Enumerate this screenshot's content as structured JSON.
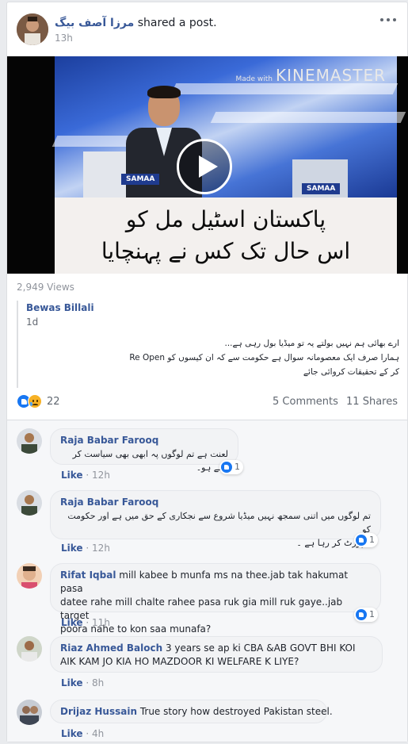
{
  "post": {
    "author": "مرزا آصف بیگ",
    "action": "shared a post.",
    "time": "13h",
    "views": "2,949 Views"
  },
  "video": {
    "watermark_prefix": "Made with",
    "watermark_brand": "KINEMASTER",
    "channel_logo": "SAMAA",
    "caption_line1": "پاکستان اسٹیل مل کو",
    "caption_line2": "اس حال تک کس نے پہنچایا"
  },
  "shared_post": {
    "author": "Bewas Billali",
    "time": "1d",
    "line1": "ارے بھائی ہم نہیں بولتے یہ تو میڈیا بول رہی ہے...",
    "line2": "ہمارا صرف ایک معصومانہ سوال ہے حکومت سے کہ ان کیسوں کو Re Open",
    "line3": "کر کے تحقیقات کروائی جائے"
  },
  "stats": {
    "reaction_count": "22",
    "comments": "5 Comments",
    "shares": "11 Shares"
  },
  "comments": [
    {
      "name": "Raja Babar Farooq",
      "text": "لعنت ہے تم لوگوں پہ ابھی بھی سیاست کر رہے ہو۔",
      "like": "Like",
      "time": "12h",
      "reactions": "1"
    },
    {
      "name": "Raja Babar Farooq",
      "text_line1": "تم لوگوں میں اتنی سمجھ نہیں میڈیا شروع سے نجکاری کے حق میں ہے اور حکومت کو",
      "text_line2": "سپورٹ کر رہا ہے ۔",
      "like": "Like",
      "time": "12h",
      "reactions": "1"
    },
    {
      "name": "Rifat Iqbal",
      "text_line1": "mill kabee b munfa ms na thee.jab tak hakumat pasa",
      "text_line2": "datee rahe mill chalte rahee pasa ruk gia mill ruk gaye..jab target",
      "text_line3": "poora nahe to kon saa munafa?",
      "like": "Like",
      "time": "11h",
      "reactions": "1"
    },
    {
      "name": "Riaz Ahmed Baloch",
      "text_line1": "3 years se ap ki CBA &AB GOVT BHI KOI",
      "text_line2": "AIK KAM JO KIA HO MAZDOOR KI WELFARE K LIYE?",
      "like": "Like",
      "time": "8h"
    },
    {
      "name": "Drijaz Hussain",
      "text": "True story how destroyed Pakistan steel.",
      "like": "Like",
      "time": "4h"
    }
  ],
  "meta_separator": "·"
}
